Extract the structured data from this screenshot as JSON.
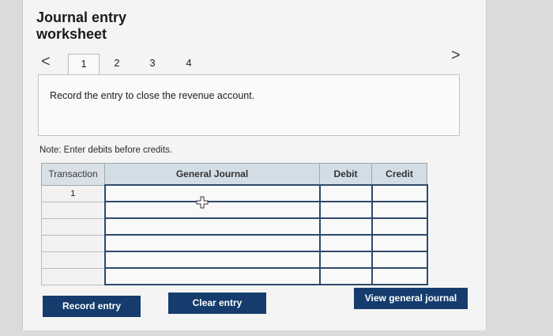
{
  "header": {
    "title_line1": "Journal entry",
    "title_line2": "worksheet"
  },
  "nav": {
    "prev_icon": "chevron-left-icon",
    "next_icon": "chevron-right-icon",
    "prev_glyph": "<",
    "next_glyph": ">",
    "tabs": [
      {
        "label": "1",
        "active": true
      },
      {
        "label": "2",
        "active": false
      },
      {
        "label": "3",
        "active": false
      },
      {
        "label": "4",
        "active": false
      }
    ]
  },
  "instruction": {
    "text": "Record the entry to close the revenue account."
  },
  "note": {
    "text": "Note: Enter debits before credits."
  },
  "table": {
    "headers": {
      "transaction": "Transaction",
      "general_journal": "General Journal",
      "debit": "Debit",
      "credit": "Credit"
    },
    "rows": [
      {
        "transaction": "1",
        "general_journal": "",
        "debit": "",
        "credit": ""
      },
      {
        "transaction": "",
        "general_journal": "",
        "debit": "",
        "credit": ""
      },
      {
        "transaction": "",
        "general_journal": "",
        "debit": "",
        "credit": ""
      },
      {
        "transaction": "",
        "general_journal": "",
        "debit": "",
        "credit": ""
      },
      {
        "transaction": "",
        "general_journal": "",
        "debit": "",
        "credit": ""
      },
      {
        "transaction": "",
        "general_journal": "",
        "debit": "",
        "credit": ""
      }
    ]
  },
  "buttons": {
    "record_entry": "Record entry",
    "clear_entry": "Clear entry",
    "view_general_journal": "View general journal"
  },
  "colors": {
    "button_bg": "#153c6d",
    "header_bg": "#d3dde6",
    "entry_border": "#2f4a6b"
  }
}
